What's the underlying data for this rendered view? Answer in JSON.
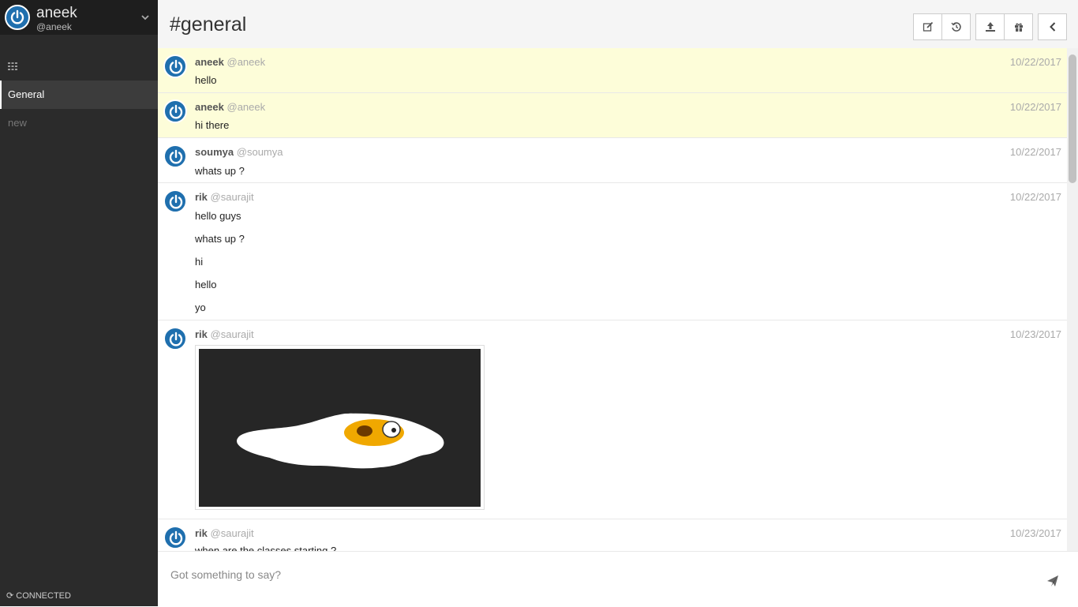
{
  "user": {
    "name": "aneek",
    "handle": "@aneek"
  },
  "sidebar": {
    "items": [
      {
        "label": "General",
        "active": true
      },
      {
        "label": "new",
        "active": false
      }
    ],
    "status": "CONNECTED"
  },
  "channel": {
    "title": "#general"
  },
  "toolbar": [
    "edit-icon",
    "history-icon",
    "upload-icon",
    "delete-icon",
    "collapse-icon"
  ],
  "messages": [
    {
      "name": "aneek",
      "handle": "@aneek",
      "date": "10/22/2017",
      "lines": [
        "hello"
      ],
      "highlight": true
    },
    {
      "name": "aneek",
      "handle": "@aneek",
      "date": "10/22/2017",
      "lines": [
        "hi there"
      ],
      "highlight": true
    },
    {
      "name": "soumya",
      "handle": "@soumya",
      "date": "10/22/2017",
      "lines": [
        "whats up ?"
      ],
      "highlight": false
    },
    {
      "name": "rik",
      "handle": "@saurajit",
      "date": "10/22/2017",
      "lines": [
        "hello guys",
        "whats up ?",
        "hi",
        "hello",
        "yo"
      ],
      "highlight": false
    },
    {
      "name": "rik",
      "handle": "@saurajit",
      "date": "10/23/2017",
      "lines": [],
      "image": "fried-egg-cartoon",
      "highlight": false
    },
    {
      "name": "rik",
      "handle": "@saurajit",
      "date": "10/23/2017",
      "lines": [
        "when are the classes starting ?"
      ],
      "highlight": false
    }
  ],
  "composer": {
    "placeholder": "Got something to say?"
  },
  "colors": {
    "sidebar": "#2b2b2b",
    "highlight": "#fdfdd9",
    "avatar": "#1f6fae"
  }
}
